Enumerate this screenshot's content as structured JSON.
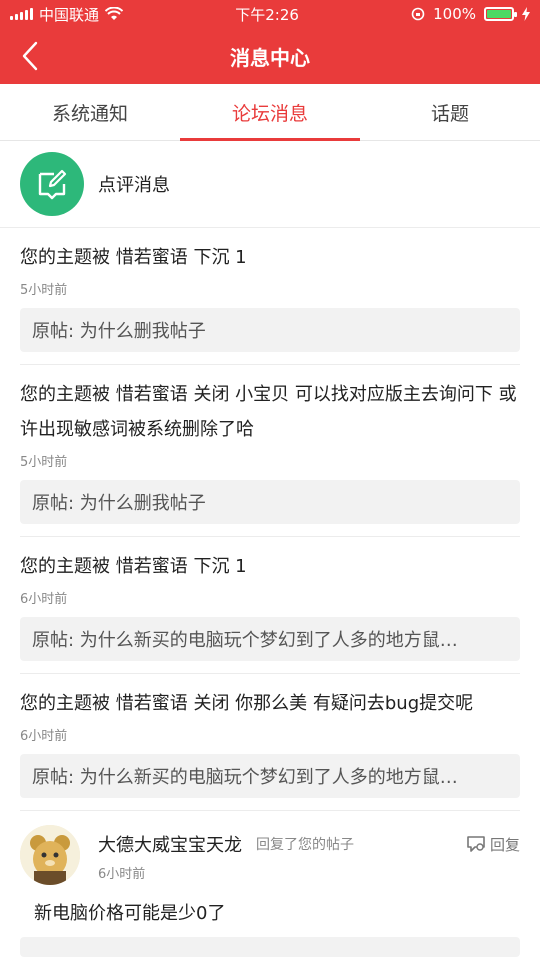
{
  "status": {
    "carrier": "中国联通",
    "time": "下午2:26",
    "battery": "100%"
  },
  "nav": {
    "title": "消息中心"
  },
  "tabs": [
    {
      "label": "系统通知"
    },
    {
      "label": "论坛消息"
    },
    {
      "label": "话题"
    }
  ],
  "review": {
    "label": "点评消息"
  },
  "messages": [
    {
      "text": "您的主题被 惜若蜜语 下沉 1",
      "time": "5小时前",
      "quote": "原帖: 为什么删我帖子"
    },
    {
      "text": "您的主题被 惜若蜜语 关闭 小宝贝 可以找对应版主去询问下 或许出现敏感词被系统删除了哈",
      "time": "5小时前",
      "quote": "原帖: 为什么删我帖子"
    },
    {
      "text": "您的主题被 惜若蜜语 下沉 1",
      "time": "6小时前",
      "quote": "原帖: 为什么新买的电脑玩个梦幻到了人多的地方鼠…"
    },
    {
      "text": "您的主题被 惜若蜜语 关闭 你那么美 有疑问去bug提交呢",
      "time": "6小时前",
      "quote": "原帖: 为什么新买的电脑玩个梦幻到了人多的地方鼠…"
    }
  ],
  "reply": {
    "user": "大德大威宝宝天龙",
    "action": "回复了您的帖子",
    "button": "回复",
    "time": "6小时前",
    "content": "新电脑价格可能是少0了"
  },
  "colors": {
    "accent": "#e93b3b",
    "review_icon_bg": "#2db87a"
  }
}
